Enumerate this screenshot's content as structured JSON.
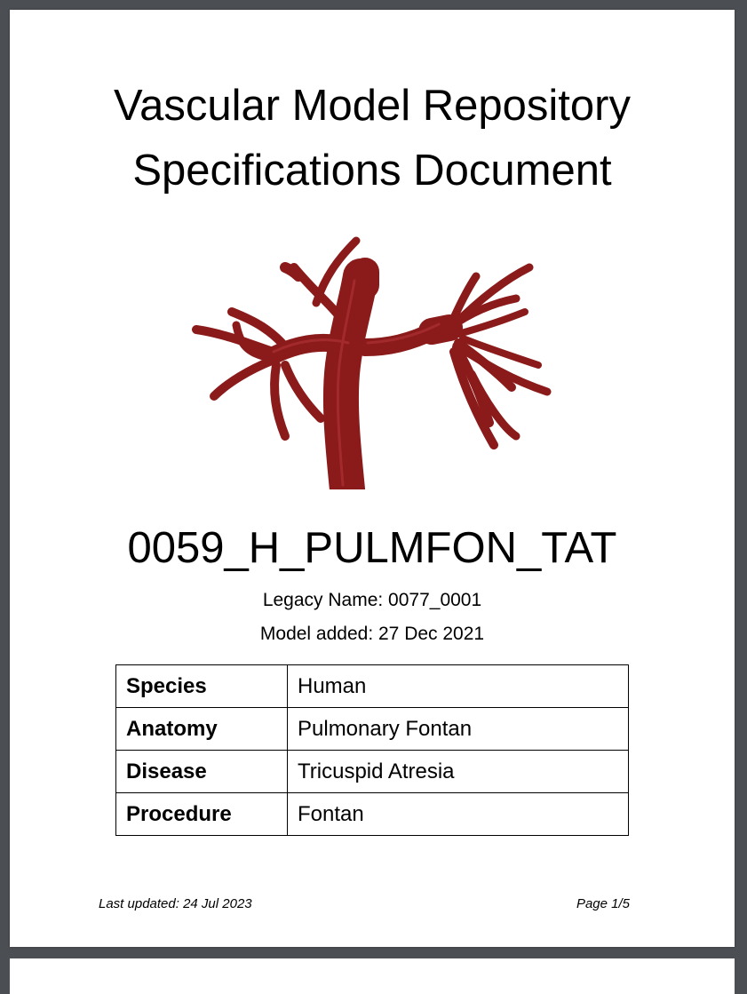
{
  "document": {
    "title_line1": "Vascular Model Repository",
    "title_line2": "Specifications Document",
    "model_id": "0059_H_PULMFON_TAT",
    "legacy_name": "Legacy Name: 0077_0001",
    "model_added": "Model added: 27 Dec 2021",
    "model_color": "#8b1a1a"
  },
  "spec_table": [
    {
      "key": "Species",
      "value": "Human"
    },
    {
      "key": "Anatomy",
      "value": "Pulmonary Fontan"
    },
    {
      "key": "Disease",
      "value": "Tricuspid Atresia"
    },
    {
      "key": "Procedure",
      "value": "Fontan"
    }
  ],
  "footer": {
    "last_updated": "Last updated: 24 Jul 2023",
    "page": "Page 1/5"
  }
}
